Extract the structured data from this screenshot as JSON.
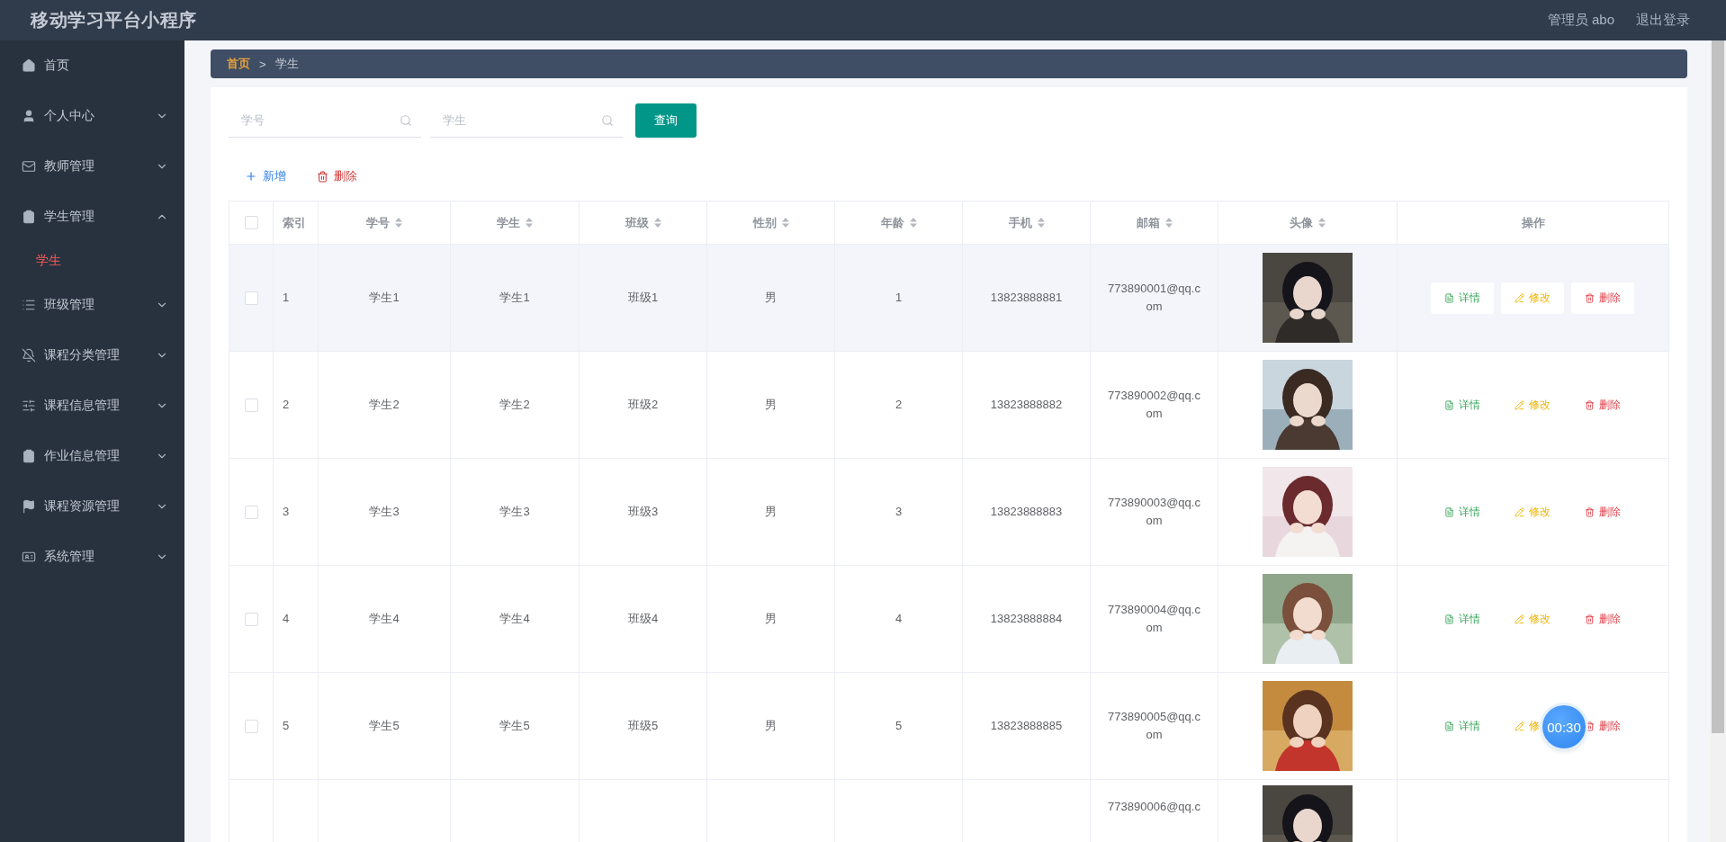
{
  "app_title": "移动学习平台小程序",
  "header_links": [
    "管理员 abo",
    "退出登录"
  ],
  "sidebar": {
    "items": [
      {
        "label": "首页"
      },
      {
        "label": "个人中心",
        "expanded": false
      },
      {
        "label": "教师管理",
        "expanded": false
      },
      {
        "label": "学生管理",
        "expanded": true,
        "children": [
          {
            "label": "学生",
            "selected": true
          }
        ]
      },
      {
        "label": "班级管理",
        "expanded": false
      },
      {
        "label": "课程分类管理",
        "expanded": false
      },
      {
        "label": "课程信息管理",
        "expanded": false
      },
      {
        "label": "作业信息管理",
        "expanded": false
      },
      {
        "label": "课程资源管理",
        "expanded": false
      },
      {
        "label": "系统管理",
        "expanded": false
      }
    ]
  },
  "breadcrumb": {
    "items": [
      "首页",
      "学生"
    ],
    "separator": ">"
  },
  "search": {
    "fields": [
      {
        "placeholder": "学号"
      },
      {
        "placeholder": "学生"
      }
    ],
    "button": "查询"
  },
  "toolbar": [
    {
      "kind": "add",
      "label": "新增"
    },
    {
      "kind": "delete",
      "label": "删除"
    }
  ],
  "table": {
    "select_all": {
      "checked": false
    },
    "columns": [
      {
        "label": "索引",
        "sortable": false
      },
      {
        "label": "学号",
        "sortable": true
      },
      {
        "label": "学生",
        "sortable": true
      },
      {
        "label": "班级",
        "sortable": true
      },
      {
        "label": "性别",
        "sortable": true
      },
      {
        "label": "年龄",
        "sortable": true
      },
      {
        "label": "手机",
        "sortable": true
      },
      {
        "label": "邮箱",
        "sortable": true
      },
      {
        "label": "头像",
        "sortable": true
      },
      {
        "label": "操作",
        "sortable": false
      }
    ],
    "rows": [
      {
        "kind": "full",
        "hovered": true,
        "checked": false,
        "index": "1",
        "student_id": "学生1",
        "name": "学生1",
        "class": "班级1",
        "gender": "男",
        "age": "1",
        "phone": "13823888881",
        "email": "773890001@qq.com",
        "actions": [
          {
            "kind": "detail",
            "label": "详情"
          },
          {
            "kind": "edit",
            "label": "修改"
          },
          {
            "kind": "delete",
            "label": "删除"
          }
        ]
      },
      {
        "kind": "full",
        "hovered": false,
        "checked": false,
        "index": "2",
        "student_id": "学生2",
        "name": "学生2",
        "class": "班级2",
        "gender": "男",
        "age": "2",
        "phone": "13823888882",
        "email": "773890002@qq.com",
        "actions": [
          {
            "kind": "detail",
            "label": "详情"
          },
          {
            "kind": "edit",
            "label": "修改"
          },
          {
            "kind": "delete",
            "label": "删除"
          }
        ]
      },
      {
        "kind": "full",
        "hovered": false,
        "checked": false,
        "index": "3",
        "student_id": "学生3",
        "name": "学生3",
        "class": "班级3",
        "gender": "男",
        "age": "3",
        "phone": "13823888883",
        "email": "773890003@qq.com",
        "actions": [
          {
            "kind": "detail",
            "label": "详情"
          },
          {
            "kind": "edit",
            "label": "修改"
          },
          {
            "kind": "delete",
            "label": "删除"
          }
        ]
      },
      {
        "kind": "full",
        "hovered": false,
        "checked": false,
        "index": "4",
        "student_id": "学生4",
        "name": "学生4",
        "class": "班级4",
        "gender": "男",
        "age": "4",
        "phone": "13823888884",
        "email": "773890004@qq.com",
        "actions": [
          {
            "kind": "detail",
            "label": "详情"
          },
          {
            "kind": "edit",
            "label": "修改"
          },
          {
            "kind": "delete",
            "label": "删除"
          }
        ]
      },
      {
        "kind": "full",
        "hovered": false,
        "checked": false,
        "index": "5",
        "student_id": "学生5",
        "name": "学生5",
        "class": "班级5",
        "gender": "男",
        "age": "5",
        "phone": "13823888885",
        "email": "773890005@qq.com",
        "actions": [
          {
            "kind": "detail",
            "label": "详情"
          },
          {
            "kind": "edit",
            "label": "修"
          },
          {
            "kind": "delete",
            "label": "删除"
          }
        ]
      },
      {
        "kind": "cut",
        "hovered": false,
        "email": "773890006@qq.c"
      }
    ]
  },
  "timer": "00:30"
}
